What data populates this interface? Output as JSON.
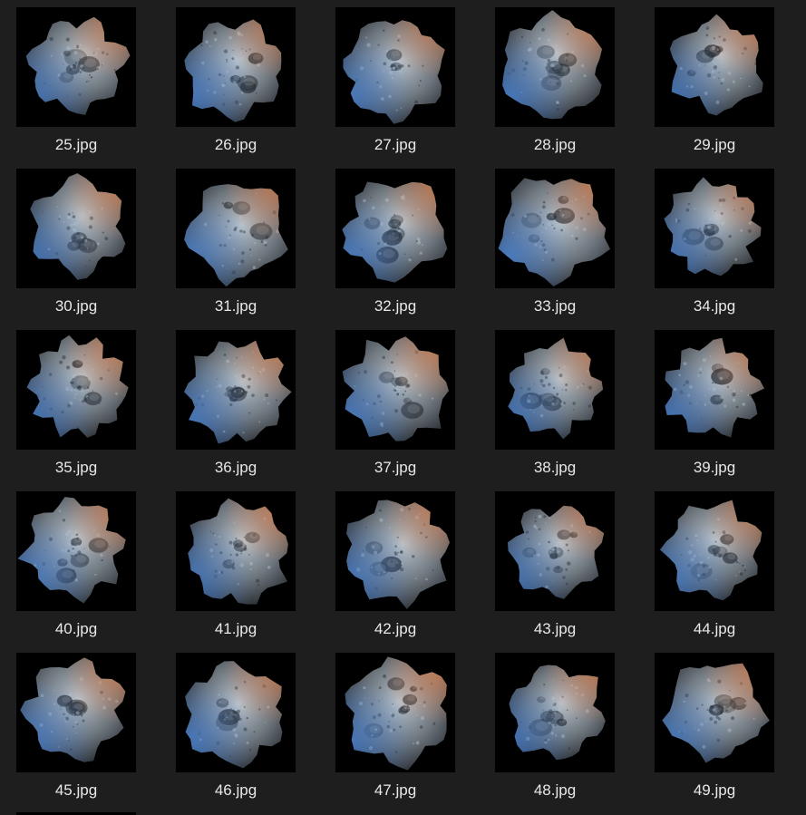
{
  "files": [
    {
      "name": "25.jpg",
      "icon": "asteroid-thumbnail"
    },
    {
      "name": "26.jpg",
      "icon": "asteroid-thumbnail"
    },
    {
      "name": "27.jpg",
      "icon": "asteroid-thumbnail"
    },
    {
      "name": "28.jpg",
      "icon": "asteroid-thumbnail"
    },
    {
      "name": "29.jpg",
      "icon": "asteroid-thumbnail"
    },
    {
      "name": "30.jpg",
      "icon": "asteroid-thumbnail"
    },
    {
      "name": "31.jpg",
      "icon": "asteroid-thumbnail"
    },
    {
      "name": "32.jpg",
      "icon": "asteroid-thumbnail"
    },
    {
      "name": "33.jpg",
      "icon": "asteroid-thumbnail"
    },
    {
      "name": "34.jpg",
      "icon": "asteroid-thumbnail"
    },
    {
      "name": "35.jpg",
      "icon": "asteroid-thumbnail"
    },
    {
      "name": "36.jpg",
      "icon": "asteroid-thumbnail"
    },
    {
      "name": "37.jpg",
      "icon": "asteroid-thumbnail"
    },
    {
      "name": "38.jpg",
      "icon": "asteroid-thumbnail"
    },
    {
      "name": "39.jpg",
      "icon": "asteroid-thumbnail"
    },
    {
      "name": "40.jpg",
      "icon": "asteroid-thumbnail"
    },
    {
      "name": "41.jpg",
      "icon": "asteroid-thumbnail"
    },
    {
      "name": "42.jpg",
      "icon": "asteroid-thumbnail"
    },
    {
      "name": "43.jpg",
      "icon": "asteroid-thumbnail"
    },
    {
      "name": "44.jpg",
      "icon": "asteroid-thumbnail"
    },
    {
      "name": "45.jpg",
      "icon": "asteroid-thumbnail"
    },
    {
      "name": "46.jpg",
      "icon": "asteroid-thumbnail"
    },
    {
      "name": "47.jpg",
      "icon": "asteroid-thumbnail"
    },
    {
      "name": "48.jpg",
      "icon": "asteroid-thumbnail"
    },
    {
      "name": "49.jpg",
      "icon": "asteroid-thumbnail"
    }
  ],
  "colors": {
    "background": "#1e1e1e",
    "thumbnail_background": "#000000",
    "label_text": "#e8e8e8",
    "rock_light": "#b9c3cc",
    "rock_mid": "#6e767e",
    "rock_dark": "#262a2f",
    "rim_blue": "#4f8fe8",
    "rim_orange": "#e8874f"
  }
}
